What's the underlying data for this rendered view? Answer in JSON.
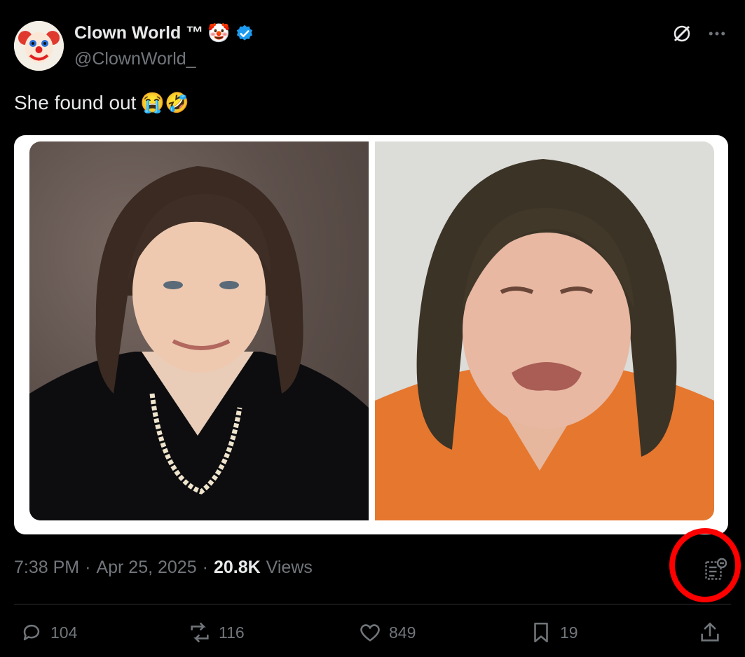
{
  "user": {
    "name": "Clown World ™",
    "name_emoji": "🤡",
    "handle": "@ClownWorld_",
    "verified": true
  },
  "tweet": {
    "text": "She found out",
    "text_emojis": "😭🤣"
  },
  "meta": {
    "time": "7:38 PM",
    "sep1": "·",
    "date": "Apr 25, 2025",
    "sep2": "·",
    "views_count": "20.8K",
    "views_label": "Views"
  },
  "actions": {
    "reply": "104",
    "repost": "116",
    "like": "849",
    "bookmark": "19"
  },
  "icons": {
    "header": [
      "grok-icon",
      "more-icon"
    ],
    "footer": [
      "reply-icon",
      "repost-icon",
      "like-icon",
      "bookmark-icon",
      "share-icon"
    ],
    "analytics": "analytics-icon"
  },
  "colors": {
    "background": "#000000",
    "text": "#e7e9ea",
    "muted": "#71767b",
    "verified": "#1d9bf0",
    "highlight": "#ff0000"
  }
}
